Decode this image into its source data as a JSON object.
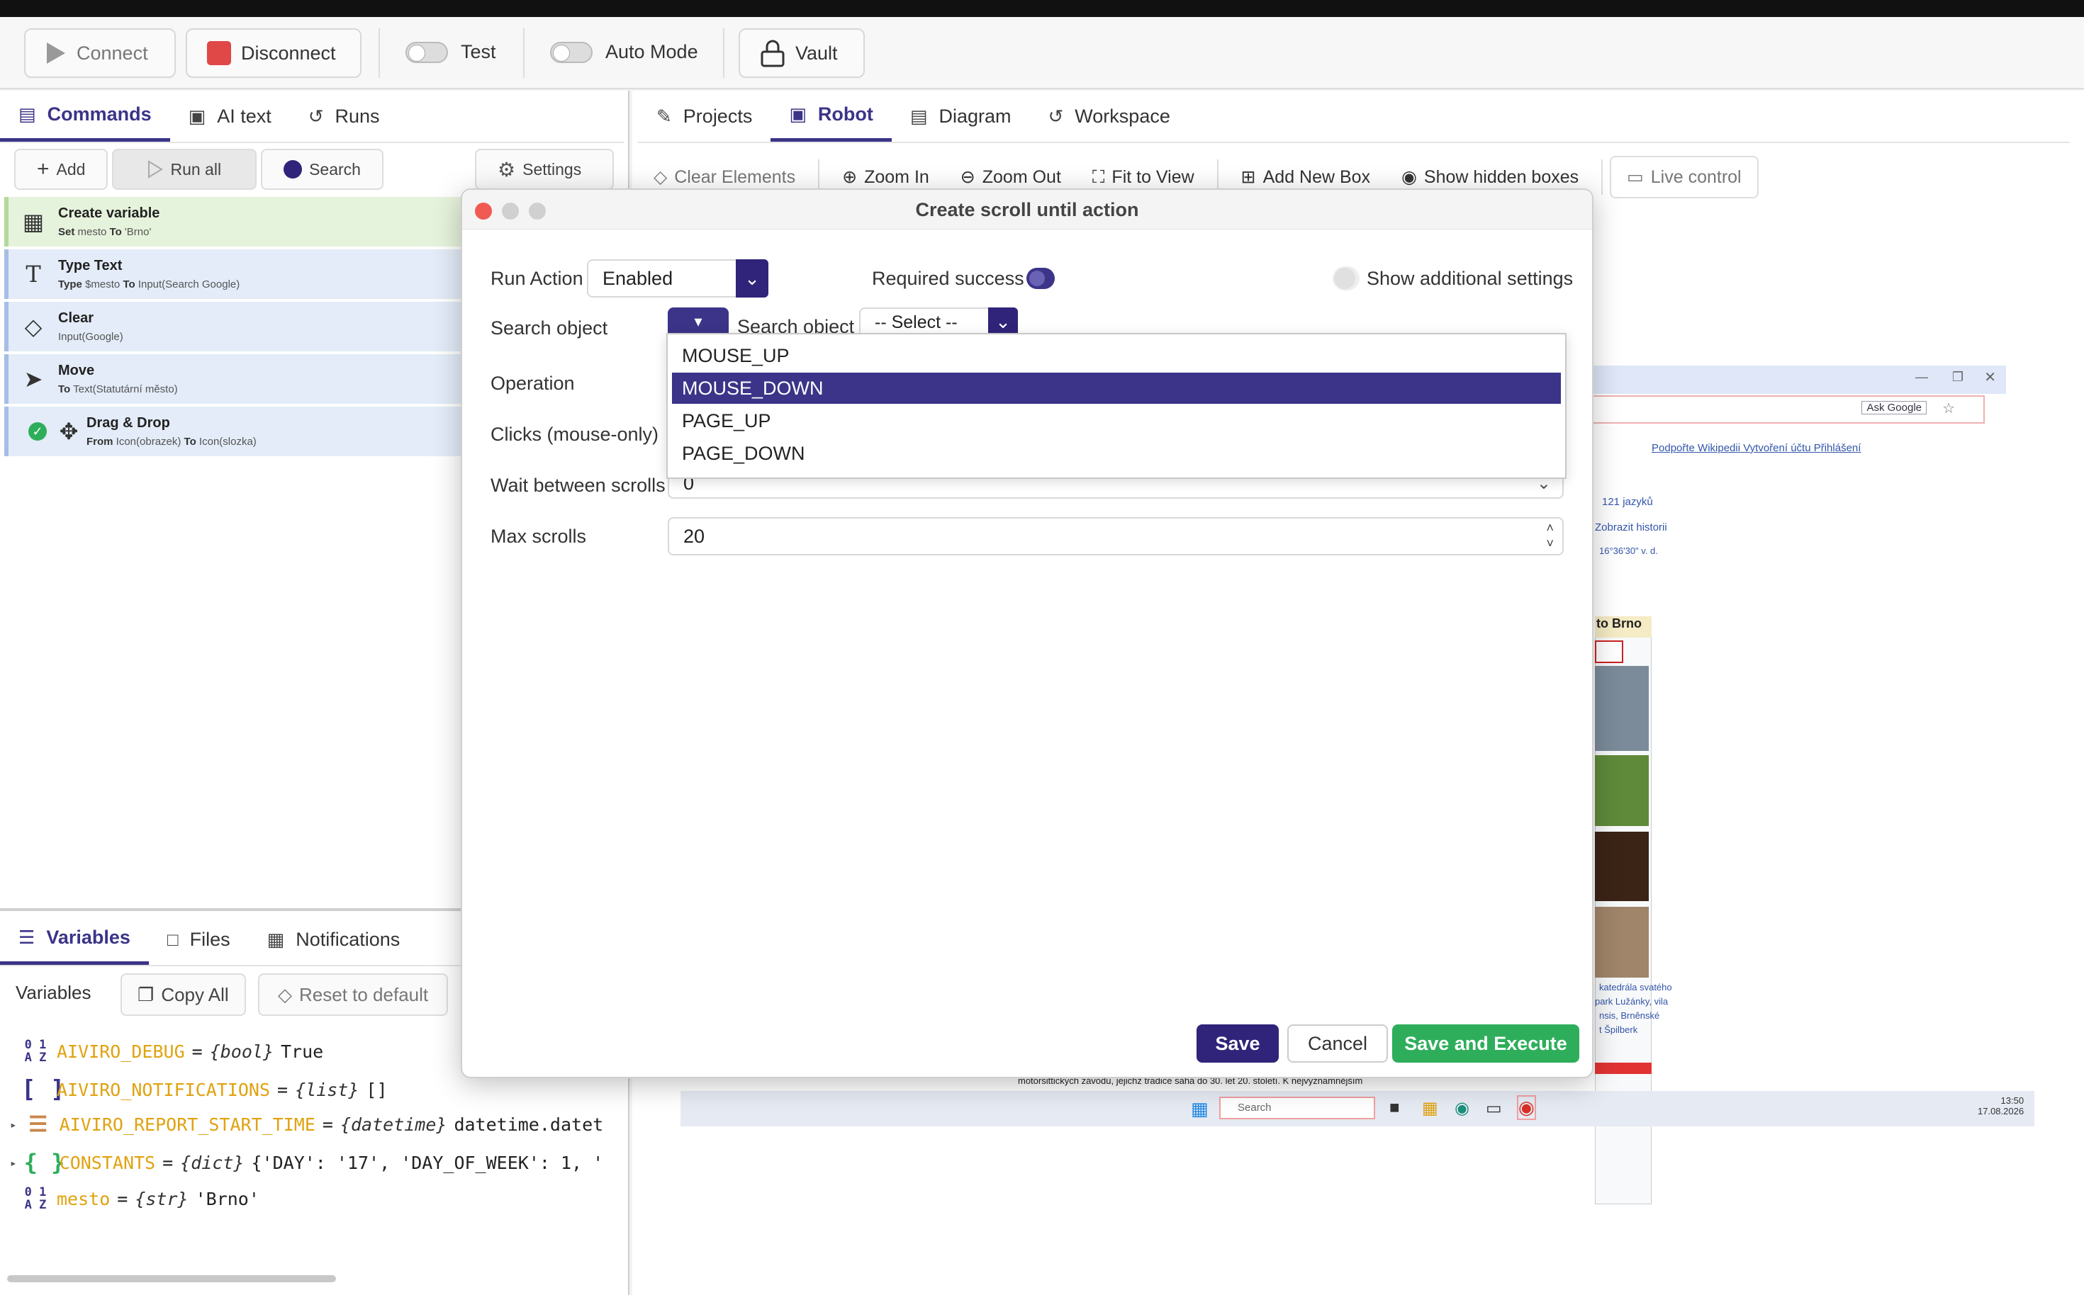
{
  "toolbar": {
    "connect": "Connect",
    "disconnect": "Disconnect",
    "test": "Test",
    "auto_mode": "Auto Mode",
    "vault": "Vault"
  },
  "left_tabs": [
    "Commands",
    "AI text",
    "Runs"
  ],
  "cmd_buttons": {
    "add": "Add",
    "run_all": "Run all",
    "search": "Search",
    "settings": "Settings"
  },
  "commands": [
    {
      "title": "Create variable",
      "sub": [
        [
          "Set",
          "b"
        ],
        [
          " mesto ",
          ""
        ],
        [
          "To",
          "b"
        ],
        [
          " 'Brno'",
          ""
        ]
      ]
    },
    {
      "title": "Type Text",
      "sub": [
        [
          "Type",
          "b"
        ],
        [
          " $mesto ",
          ""
        ],
        [
          "To",
          "b"
        ],
        [
          " Input(Search Google)",
          ""
        ]
      ]
    },
    {
      "title": "Clear",
      "sub": [
        [
          "Input(Google)",
          ""
        ]
      ]
    },
    {
      "title": "Move",
      "sub": [
        [
          "To",
          "b"
        ],
        [
          " Text(Statutární město)",
          ""
        ]
      ]
    },
    {
      "title": "Drag & Drop",
      "sub": [
        [
          "From",
          "b"
        ],
        [
          " Icon(obrazek) ",
          ""
        ],
        [
          "To",
          "b"
        ],
        [
          " Icon(slozka)",
          ""
        ]
      ]
    }
  ],
  "bottom_tabs": [
    "Variables",
    "Files",
    "Notifications"
  ],
  "variables_toolbar": {
    "label": "Variables",
    "copy_all": "Copy All",
    "reset": "Reset to default"
  },
  "variables": [
    {
      "name": "AIVIRO_DEBUG",
      "type": "{bool}",
      "value": "True"
    },
    {
      "name": "AIVIRO_NOTIFICATIONS",
      "type": "{list}",
      "value": "[]"
    },
    {
      "name": "AIVIRO_REPORT_START_TIME",
      "type": "{datetime}",
      "value": "datetime.datet"
    },
    {
      "name": "CONSTANTS",
      "type": "{dict}",
      "value": "{'DAY': '17', 'DAY_OF_WEEK': 1, '"
    },
    {
      "name": "mesto",
      "type": "{str}",
      "value": "'Brno'"
    }
  ],
  "right_tabs": [
    "Projects",
    "Robot",
    "Diagram",
    "Workspace"
  ],
  "canvas_toolbar": {
    "clear": "Clear Elements",
    "zoom_in": "Zoom In",
    "zoom_out": "Zoom Out",
    "fit": "Fit to View",
    "add_box": "Add New Box",
    "hidden": "Show hidden boxes",
    "live": "Live control"
  },
  "preview": {
    "ask_google": "Ask Google",
    "wiki_links": "Podpořte Wikipedii  Vytvoření účtu  Přihlášení",
    "languages": "121 jazyků",
    "history": "Zobrazit historii",
    "coords": "16°36'30\" v. d.",
    "city_header": "to Brno",
    "caption1": "katedrála svatého",
    "caption2": "park Lužánky, vila",
    "caption3": "nsis, Brněnské",
    "caption4": "t Špilberk",
    "taskbar_search": "Search",
    "clock_time": "13:50",
    "clock_date": "17.08.2026",
    "page_text": "motorsittických závodu, jejichž tradice sahá do 30. let 20. století. K nejvýznamnějším"
  },
  "dialog": {
    "title": "Create scroll until action",
    "run_action_label": "Run Action",
    "run_action_value": "Enabled",
    "required_success": "Required success",
    "show_additional": "Show additional settings",
    "search_object_label": "Search object",
    "search_object_inner": "Search object",
    "select_placeholder": "-- Select --",
    "operation_label": "Operation",
    "clicks_label": "Clicks (mouse-only)",
    "wait_label": "Wait between scrolls",
    "wait_value": "0",
    "max_label": "Max scrolls",
    "max_value": "20",
    "options": [
      "MOUSE_UP",
      "MOUSE_DOWN",
      "PAGE_UP",
      "PAGE_DOWN"
    ],
    "selected_option": "MOUSE_DOWN",
    "save": "Save",
    "cancel": "Cancel",
    "save_execute": "Save and Execute"
  },
  "colors": {
    "accent": "#3b3488",
    "save_execute": "#2eae5b",
    "disconnect": "#e04848",
    "variable_name": "#e0a20f"
  }
}
